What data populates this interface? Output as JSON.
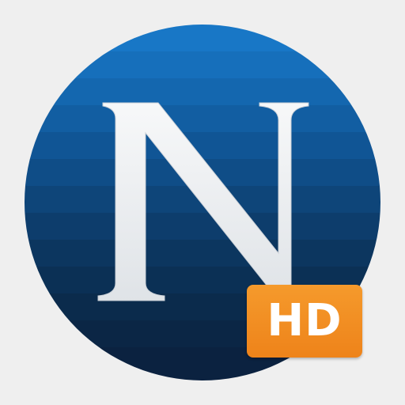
{
  "app_icon": {
    "letter": "N",
    "badge_label": "HD"
  },
  "colors": {
    "background": "#efefef",
    "circle_top": "#1877c6",
    "circle_bottom": "#0b2540",
    "letter_fill": "#f2f4f6",
    "badge": "#f08a1e",
    "badge_text": "#ffffff"
  },
  "icons": [
    "striped-circle-icon",
    "n-letter-icon",
    "hd-badge-icon"
  ]
}
